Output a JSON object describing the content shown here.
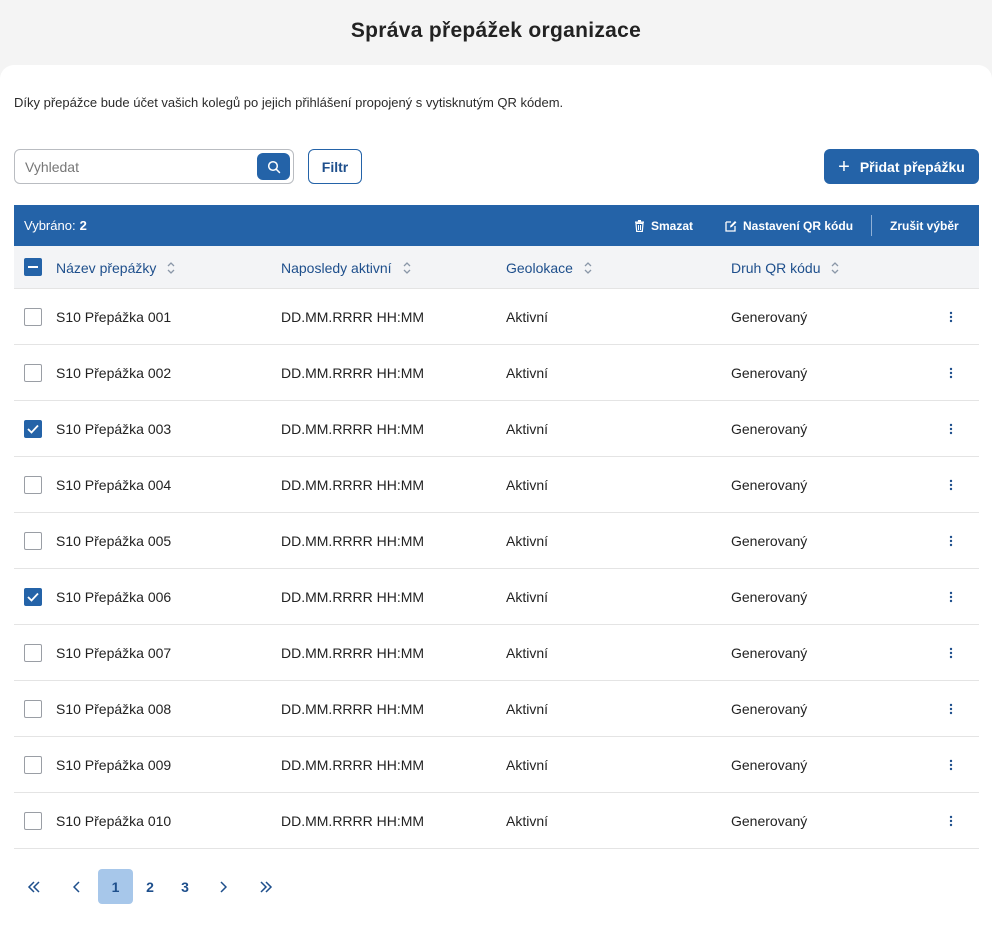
{
  "title": "Správa přepážek organizace",
  "intro": "Díky přepážce bude účet vašich kolegů po jejich přihlášení propojený s vytisknutým QR kódem.",
  "search": {
    "placeholder": "Vyhledat"
  },
  "filter_label": "Filtr",
  "add_label": "Přidat přepážku",
  "selection": {
    "label": "Vybráno:",
    "count": "2",
    "delete_label": "Smazat",
    "qr_settings_label": "Nastavení QR kódu",
    "clear_label": "Zrušit výběr"
  },
  "columns": [
    "Název přepážky",
    "Naposledy aktivní",
    "Geolokace",
    "Druh QR kódu"
  ],
  "rows": [
    {
      "name": "S10 Přepážka 001",
      "last_active": "DD.MM.RRRR HH:MM",
      "geo": "Aktivní",
      "qr": "Generovaný",
      "checked": false
    },
    {
      "name": "S10 Přepážka 002",
      "last_active": "DD.MM.RRRR HH:MM",
      "geo": "Aktivní",
      "qr": "Generovaný",
      "checked": false
    },
    {
      "name": "S10 Přepážka 003",
      "last_active": "DD.MM.RRRR HH:MM",
      "geo": "Aktivní",
      "qr": "Generovaný",
      "checked": true
    },
    {
      "name": "S10 Přepážka 004",
      "last_active": "DD.MM.RRRR HH:MM",
      "geo": "Aktivní",
      "qr": "Generovaný",
      "checked": false
    },
    {
      "name": "S10 Přepážka 005",
      "last_active": "DD.MM.RRRR HH:MM",
      "geo": "Aktivní",
      "qr": "Generovaný",
      "checked": false
    },
    {
      "name": "S10 Přepážka 006",
      "last_active": "DD.MM.RRRR HH:MM",
      "geo": "Aktivní",
      "qr": "Generovaný",
      "checked": true
    },
    {
      "name": "S10 Přepážka 007",
      "last_active": "DD.MM.RRRR HH:MM",
      "geo": "Aktivní",
      "qr": "Generovaný",
      "checked": false
    },
    {
      "name": "S10 Přepážka 008",
      "last_active": "DD.MM.RRRR HH:MM",
      "geo": "Aktivní",
      "qr": "Generovaný",
      "checked": false
    },
    {
      "name": "S10 Přepážka 009",
      "last_active": "DD.MM.RRRR HH:MM",
      "geo": "Aktivní",
      "qr": "Generovaný",
      "checked": false
    },
    {
      "name": "S10 Přepážka 010",
      "last_active": "DD.MM.RRRR HH:MM",
      "geo": "Aktivní",
      "qr": "Generovaný",
      "checked": false
    }
  ],
  "pagination": {
    "pages": [
      "1",
      "2",
      "3"
    ],
    "current": "1"
  },
  "colors": {
    "primary": "#2463a8",
    "page_active": "#a7c7ea",
    "link": "#1e4f8c"
  },
  "icons": [
    "search-icon",
    "plus-icon",
    "trash-icon",
    "edit-icon",
    "sort-icon",
    "checkbox-indeterminate-icon",
    "check-icon",
    "kebab-icon",
    "chevron-double-left-icon",
    "chevron-left-icon",
    "chevron-right-icon",
    "chevron-double-right-icon"
  ]
}
